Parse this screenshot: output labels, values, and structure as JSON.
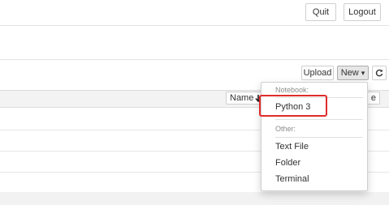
{
  "header": {
    "quit_label": "Quit",
    "logout_label": "Logout"
  },
  "toolbar": {
    "upload_label": "Upload",
    "new_label": "New",
    "new_caret": "▾",
    "refresh_icon": "refresh-icon"
  },
  "list": {
    "name_column_label": "Name",
    "name_sort_icon": "arrow-down-icon",
    "size_column_label_partial": "e"
  },
  "new_menu": {
    "notebook_header": "Notebook:",
    "notebook_items": [
      "Python 3"
    ],
    "other_header": "Other:",
    "other_items": [
      "Text File",
      "Folder",
      "Terminal"
    ]
  },
  "annotation": {
    "highlight_color": "#e12b2b"
  }
}
